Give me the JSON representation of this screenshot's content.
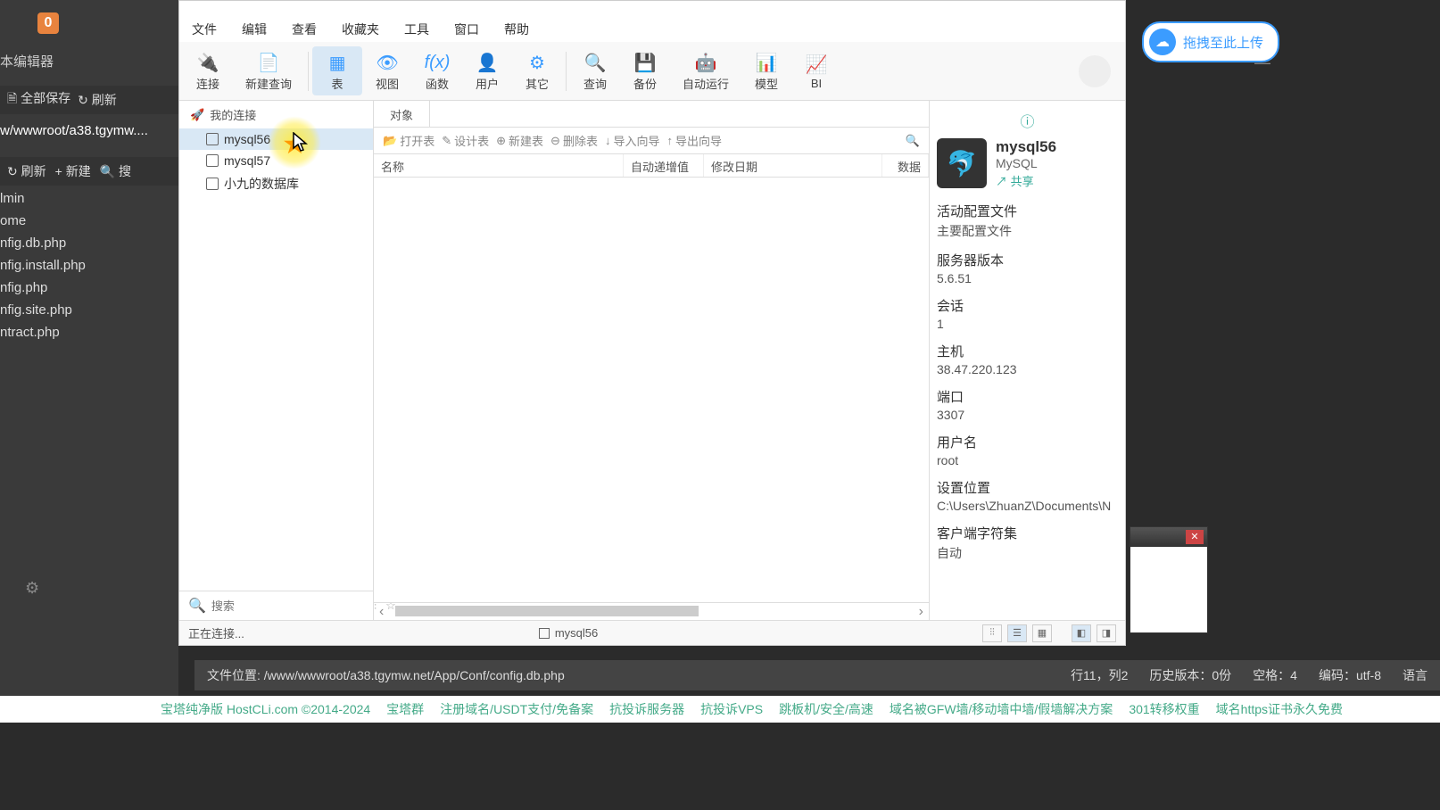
{
  "bg": {
    "badge": "0",
    "title": "本编辑器",
    "toolbar1": {
      "save_all": "全部保存",
      "refresh": "刷新"
    },
    "path": "w/wwwroot/a38.tgymw....",
    "toolbar2": {
      "refresh": "刷新",
      "new": "新建",
      "search": "搜"
    },
    "files": [
      "lmin",
      "ome",
      "nfig.db.php",
      "nfig.install.php",
      "nfig.php",
      "nfig.site.php",
      "ntract.php"
    ]
  },
  "navicat": {
    "menu": [
      "文件",
      "编辑",
      "查看",
      "收藏夹",
      "工具",
      "窗口",
      "帮助"
    ],
    "toolbar": [
      {
        "label": "连接",
        "icon": "🔌"
      },
      {
        "label": "新建查询",
        "icon": "📄"
      },
      {
        "label": "表",
        "icon": "▦",
        "active": true
      },
      {
        "label": "视图",
        "icon": "👁"
      },
      {
        "label": "函数",
        "icon": "f(x)"
      },
      {
        "label": "用户",
        "icon": "👤"
      },
      {
        "label": "其它",
        "icon": "⚙"
      },
      {
        "label": "查询",
        "icon": "🔍"
      },
      {
        "label": "备份",
        "icon": "💾"
      },
      {
        "label": "自动运行",
        "icon": "🤖"
      },
      {
        "label": "模型",
        "icon": "📊"
      },
      {
        "label": "BI",
        "icon": "📈"
      }
    ],
    "sidebar": {
      "header": "我的连接",
      "items": [
        "mysql56",
        "mysql57",
        "小九的数据库"
      ],
      "search_placeholder": "搜索"
    },
    "tabs": [
      "对象"
    ],
    "actions": [
      "打开表",
      "设计表",
      "新建表",
      "删除表",
      "导入向导",
      "导出向导"
    ],
    "columns": {
      "name": "名称",
      "auto": "自动递增值",
      "modify": "修改日期",
      "data": "数据"
    },
    "info": {
      "title": "mysql56",
      "subtitle": "MySQL",
      "share": "共享",
      "sections": [
        {
          "label": "活动配置文件",
          "value": "主要配置文件"
        },
        {
          "label": "服务器版本",
          "value": "5.6.51"
        },
        {
          "label": "会话",
          "value": "1"
        },
        {
          "label": "主机",
          "value": "38.47.220.123"
        },
        {
          "label": "端口",
          "value": "3307"
        },
        {
          "label": "用户名",
          "value": "root"
        },
        {
          "label": "设置位置",
          "value": "C:\\Users\\ZhuanZ\\Documents\\N"
        },
        {
          "label": "客户端字符集",
          "value": "自动"
        }
      ]
    },
    "status": {
      "connecting": "正在连接...",
      "db": "mysql56"
    }
  },
  "upload": {
    "label": "拖拽至此上传"
  },
  "bottom_status": {
    "file_location_label": "文件位置:",
    "file_location": "/www/wwwroot/a38.tgymw.net/App/Conf/config.db.php",
    "row_col": "行11，列2",
    "history": "历史版本：0份",
    "spaces": "空格：4",
    "encoding": "编码：utf-8",
    "lang": "语言"
  },
  "bottom_links": {
    "copy": "宝塔纯净版 HostCLi.com ©2014-2024",
    "items": [
      "宝塔群",
      "注册域名/USDT支付/免备案",
      "抗投诉服务器",
      "抗投诉VPS",
      "跳板机/安全/高速",
      "域名被GFW墙/移动墙中墙/假墙解决方案",
      "301转移权重",
      "域名https证书永久免费"
    ]
  }
}
